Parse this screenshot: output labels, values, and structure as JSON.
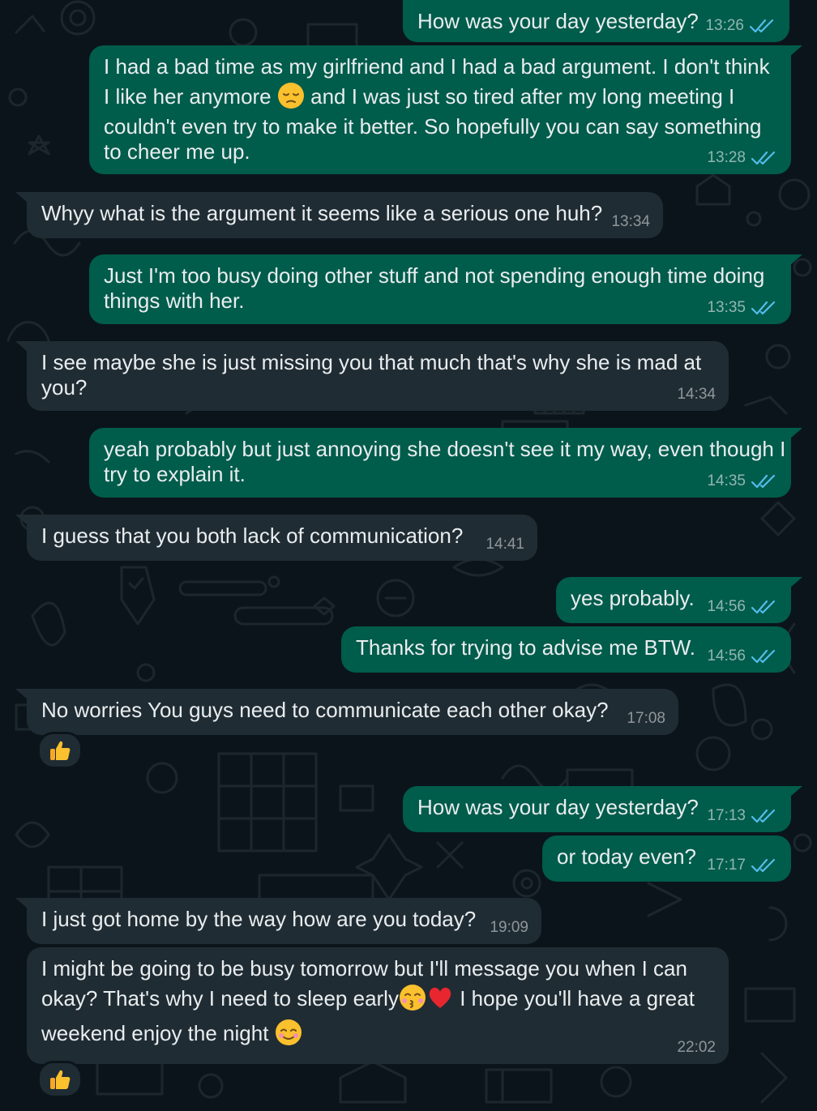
{
  "icons": {
    "read_receipt": "double-check-icon",
    "reaction": "thumbs-up-icon",
    "emoji_pensive": "pensive-face-emoji-icon",
    "emoji_kiss": "kissing-closed-eyes-emoji-icon",
    "emoji_heart": "red-heart-emoji-icon",
    "emoji_smile": "smiling-face-emoji-icon"
  },
  "colors": {
    "background": "#0b141a",
    "outgoing_bubble": "#005c4b",
    "incoming_bubble": "#202c33",
    "read_tick": "#53bdeb",
    "text": "#e9edef"
  },
  "messages": [
    {
      "dir": "out",
      "lines": [
        "How was your day yesterday?"
      ],
      "time": "13:26"
    },
    {
      "dir": "out",
      "lines": [
        "I had a bad time as my girlfriend and I had a bad argument. I don't think",
        "I like her anymore",
        "and I was just so tired after my long meeting I",
        "couldn't even try to make it better. So hopefully you can say something",
        "to cheer me up."
      ],
      "time": "13:28"
    },
    {
      "dir": "in",
      "lines": [
        "Whyy what is the argument it seems like a serious one huh?"
      ],
      "time": "13:34"
    },
    {
      "dir": "out",
      "lines": [
        "Just I'm too busy doing other stuff and not spending enough time doing",
        "things with her."
      ],
      "time": "13:35"
    },
    {
      "dir": "in",
      "lines": [
        "I see maybe she is just missing you that much that's why she is mad at",
        "you?"
      ],
      "time": "14:34"
    },
    {
      "dir": "out",
      "lines": [
        "yeah probably but just annoying she doesn't see it my way, even though I",
        "try to explain it."
      ],
      "time": "14:35"
    },
    {
      "dir": "in",
      "lines": [
        "I guess that you both lack of communication?"
      ],
      "time": "14:41"
    },
    {
      "dir": "out",
      "lines": [
        "yes probably."
      ],
      "time": "14:56"
    },
    {
      "dir": "out",
      "lines": [
        "Thanks for trying to advise me BTW."
      ],
      "time": "14:56"
    },
    {
      "dir": "in",
      "lines": [
        "No worries You guys need to communicate each other okay?"
      ],
      "time": "17:08",
      "reaction": "👍"
    },
    {
      "dir": "out",
      "lines": [
        "How was your day yesterday?"
      ],
      "time": "17:13"
    },
    {
      "dir": "out",
      "lines": [
        "or today even?"
      ],
      "time": "17:17"
    },
    {
      "dir": "in",
      "lines": [
        "I just got home by the way how are you today?"
      ],
      "time": "19:09"
    },
    {
      "dir": "in",
      "lines": [
        "I might be going to be busy tomorrow but I'll message you when I can",
        "okay? That's why I need to sleep early",
        "I hope you'll have a great",
        "weekend enjoy the night"
      ],
      "time": "22:02",
      "reaction": "👍"
    }
  ]
}
